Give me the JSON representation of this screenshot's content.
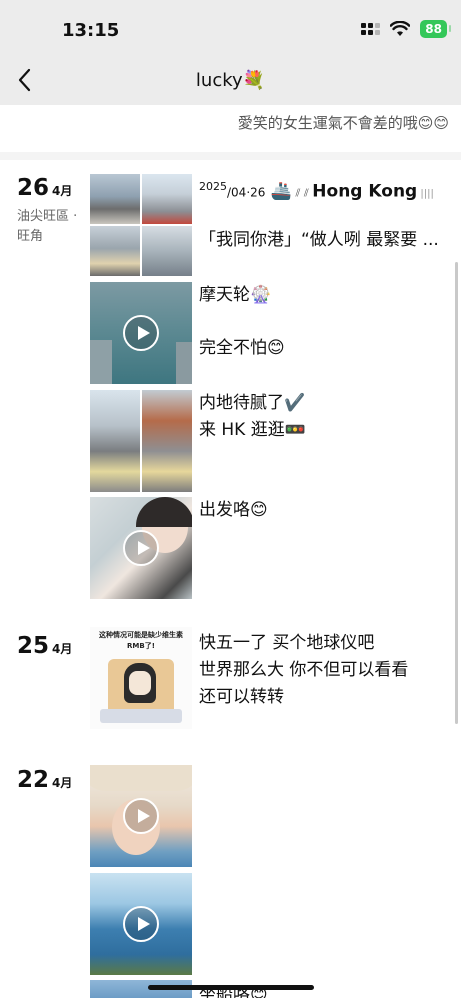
{
  "status_bar": {
    "time": "13:15",
    "battery": "88"
  },
  "nav": {
    "title": "lucky💐"
  },
  "profile": {
    "signature": "愛笑的女生運氣不會差的哦😊😊"
  },
  "timeline": [
    {
      "day": "26",
      "month": "4月",
      "location": "油尖旺區 · 旺角",
      "posts": [
        {
          "type": "photo-grid",
          "text_parts": {
            "year": "2025",
            "date": "/04·26",
            "ship": "🚢",
            "place": "Hong Kong"
          },
          "text_line2": "「我同你港」“做人咧 最緊要 ..."
        },
        {
          "type": "video",
          "text_lines": [
            "摩天轮🎡",
            "完全不怕😊"
          ]
        },
        {
          "type": "photo",
          "text_lines": [
            "内地待腻了✔️",
            "来 HK 逛逛🚥"
          ]
        },
        {
          "type": "video",
          "text_lines": [
            "出发咯😊"
          ]
        }
      ]
    },
    {
      "day": "25",
      "month": "4月",
      "posts": [
        {
          "type": "meme",
          "meme_caption": "这种情况可能是缺少维生素RMB了!",
          "text_lines": [
            "快五一了 买个地球仪吧",
            "世界那么大 你不但可以看看",
            "还可以转转"
          ]
        }
      ]
    },
    {
      "day": "22",
      "month": "4月",
      "posts": [
        {
          "type": "video",
          "text_lines": []
        },
        {
          "type": "video",
          "text_lines": []
        },
        {
          "type": "video",
          "text_lines": [
            "坐船咯😊"
          ]
        }
      ]
    }
  ],
  "colors": {
    "accent_green": "#34c759",
    "band": "#ececec"
  }
}
